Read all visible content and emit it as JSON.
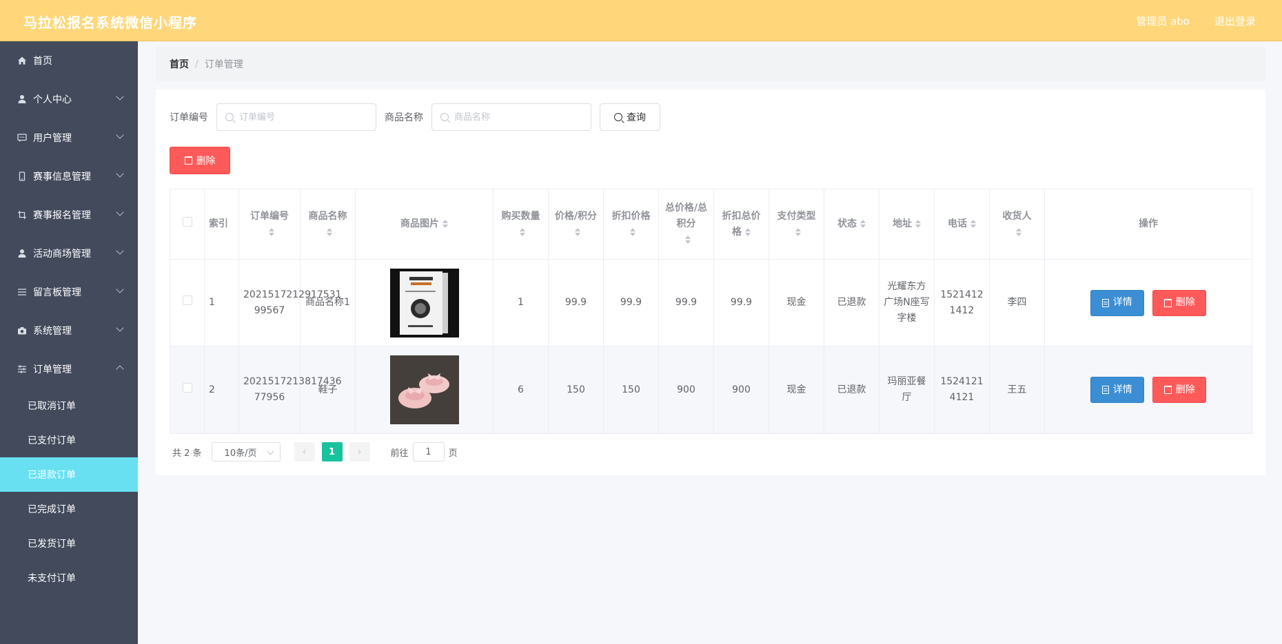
{
  "header": {
    "title": "马拉松报名系统微信小程序",
    "admin": "管理员 abo",
    "logout": "退出登录"
  },
  "sidebar": {
    "items": [
      {
        "label": "首页",
        "icon": "home-icon"
      },
      {
        "label": "个人中心",
        "icon": "user-icon"
      },
      {
        "label": "用户管理",
        "icon": "chat-icon"
      },
      {
        "label": "赛事信息管理",
        "icon": "phone-icon"
      },
      {
        "label": "赛事报名管理",
        "icon": "crop-icon"
      },
      {
        "label": "活动商场管理",
        "icon": "user-icon"
      },
      {
        "label": "留言板管理",
        "icon": "list-icon"
      },
      {
        "label": "系统管理",
        "icon": "camera-icon"
      },
      {
        "label": "订单管理",
        "icon": "sliders-icon"
      }
    ],
    "subitems": [
      "已取消订单",
      "已支付订单",
      "已退款订单",
      "已完成订单",
      "已发货订单",
      "未支付订单"
    ],
    "active_subitem": "已退款订单"
  },
  "breadcrumb": {
    "home": "首页",
    "separator": "/",
    "current": "订单管理"
  },
  "search": {
    "order_no_label": "订单编号",
    "order_no_placeholder": "订单编号",
    "product_label": "商品名称",
    "product_placeholder": "商品名称",
    "query_label": "查询"
  },
  "toolbar": {
    "delete_label": "删除"
  },
  "table": {
    "headers": {
      "index": "索引",
      "order_no": "订单编号",
      "product_name": "商品名称",
      "product_image": "商品图片",
      "quantity": "购买数量",
      "price": "价格/积分",
      "discount_price": "折扣价格",
      "total": "总价格/总积分",
      "discount_total": "折扣总价格",
      "pay_type": "支付类型",
      "status": "状态",
      "address": "地址",
      "phone": "电话",
      "receiver": "收货人",
      "actions": "操作"
    },
    "rows": [
      {
        "index": "1",
        "order_no": "2021517212917531 99567",
        "product_name": "商品名称1",
        "image": "book-cover-image",
        "quantity": "1",
        "price": "99.9",
        "discount_price": "99.9",
        "total": "99.9",
        "discount_total": "99.9",
        "pay_type": "现金",
        "status": "已退款",
        "address": "光耀东方广场N座写字楼",
        "phone": "15214121412",
        "receiver": "李四"
      },
      {
        "index": "2",
        "order_no": "2021517213817436 77956",
        "product_name": "鞋子",
        "image": "pink-shoes-image",
        "quantity": "6",
        "price": "150",
        "discount_price": "150",
        "total": "900",
        "discount_total": "900",
        "pay_type": "现金",
        "status": "已退款",
        "address": "玛丽亚餐厅",
        "phone": "15241214121",
        "receiver": "王五"
      }
    ],
    "detail_label": "详情",
    "delete_label": "删除"
  },
  "pagination": {
    "total": "共 2 条",
    "page_size": "10条/页",
    "current_page": "1",
    "goto_prefix": "前往",
    "goto_value": "1",
    "goto_suffix": "页"
  },
  "colors": {
    "header_bg": "#ffd77a",
    "sidebar_bg": "#424a5c",
    "sidebar_active": "#68e0f2",
    "danger": "#ff5a5a",
    "primary": "#3b8ed3",
    "pager_active": "#18c29c"
  }
}
